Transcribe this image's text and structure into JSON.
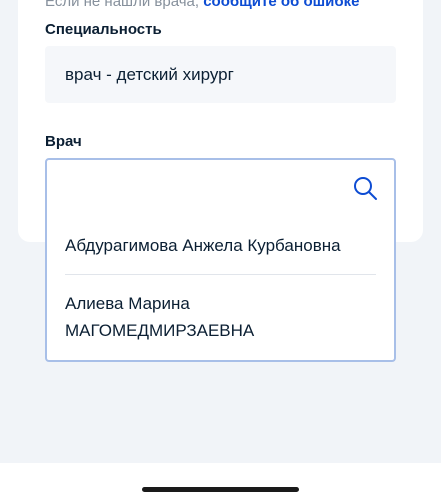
{
  "hint": {
    "text": "Если не нашли врача, ",
    "link": "сообщите об ошибке"
  },
  "specialty": {
    "label": "Специальность",
    "value": "врач - детский хирург"
  },
  "doctor": {
    "label": "Врач",
    "input_value": "",
    "search_icon": "search-icon",
    "options": [
      "Абдурагимова Анжела Курбановна",
      "Алиева Марина МАГОМЕДМИРЗАЕВНА"
    ]
  },
  "colors": {
    "link": "#0d4cd3",
    "input_border": "#a8bfe8",
    "background": "#f1f4f8"
  }
}
